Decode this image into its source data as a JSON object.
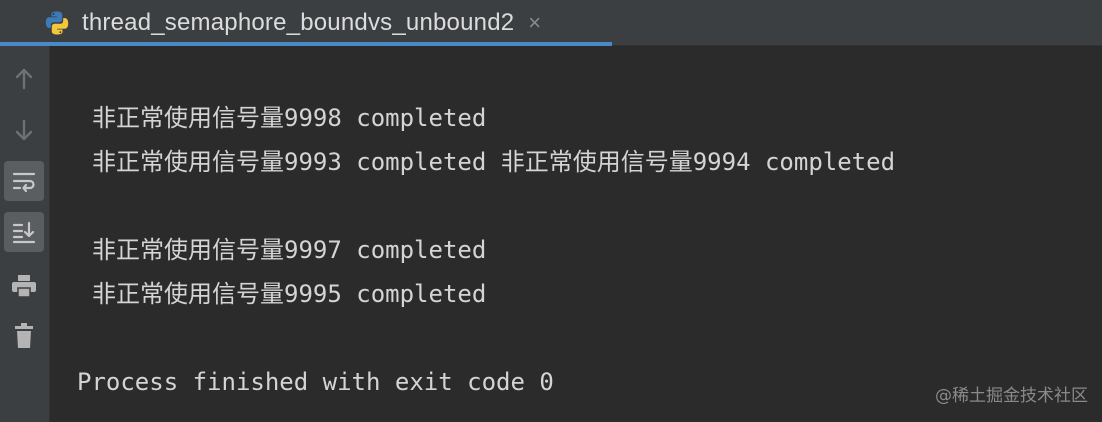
{
  "tab": {
    "icon": "python-icon",
    "title": "thread_semaphore_boundvs_unbound2",
    "close_glyph": "×"
  },
  "toolbar": {
    "items": [
      {
        "icon": "arrow-up-icon",
        "active": false
      },
      {
        "icon": "arrow-down-icon",
        "active": false
      },
      {
        "icon": "soft-wrap-icon",
        "active": true
      },
      {
        "icon": "scroll-to-end-icon",
        "active": true
      },
      {
        "icon": "print-icon",
        "active": false
      },
      {
        "icon": "trash-icon",
        "active": false
      }
    ]
  },
  "console": {
    "lines": [
      "非正常使用信号量9998 completed",
      "非正常使用信号量9993 completed 非正常使用信号量9994 completed",
      "非正常使用信号量9997 completed",
      "非正常使用信号量9995 completed",
      "Process finished with exit code 0"
    ]
  },
  "watermark": "@稀土掘金技术社区",
  "colors": {
    "background": "#2b2b2b",
    "panel": "#3c3f41",
    "text": "#d4d4d4",
    "tab_underline": "#4a88c7",
    "icon": "#8c8c8c"
  }
}
